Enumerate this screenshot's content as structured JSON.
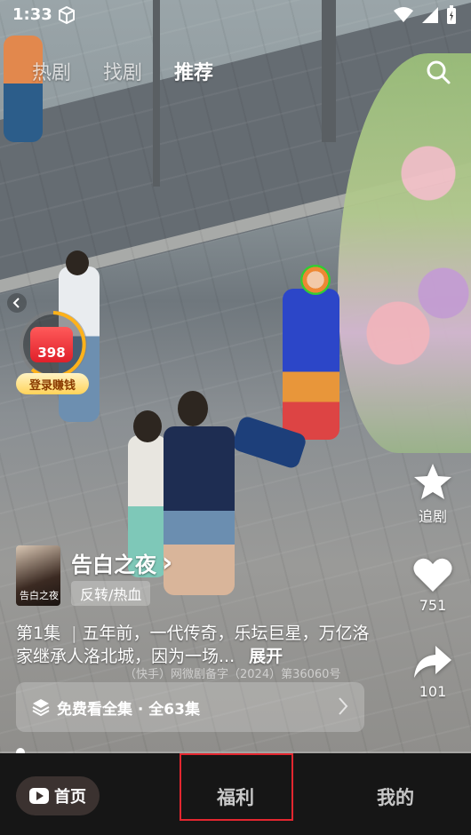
{
  "status_bar": {
    "time": "1:33",
    "icons": [
      "cube-icon",
      "wifi-icon",
      "signal-icon",
      "battery-icon"
    ]
  },
  "top_tabs": [
    {
      "label": "热剧",
      "active": false
    },
    {
      "label": "找剧",
      "active": false
    },
    {
      "label": "推荐",
      "active": true
    }
  ],
  "reward": {
    "amount": "398",
    "label": "登录赚钱"
  },
  "side_actions": {
    "follow_label": "追剧",
    "like_count": "751",
    "share_count": "101"
  },
  "series": {
    "title": "告白之夜",
    "title_chevron": "›",
    "tag": "反转/热血",
    "poster_text": "告白之夜",
    "episode_label": "第1集",
    "separator": "|",
    "description": "五年前，一代传奇，乐坛巨星，万亿洛家继承人洛北城，因为一场...",
    "expand": "展开",
    "license": "（快手）网微剧备字（2024）第36060号",
    "watch_all": "免费看全集 · 全63集"
  },
  "bottom_nav": {
    "home": "首页",
    "welfare": "福利",
    "mine": "我的"
  },
  "colors": {
    "accent_red": "#e3262f",
    "reward_red": "#e0202a",
    "reward_gold": "#ffd35a"
  }
}
